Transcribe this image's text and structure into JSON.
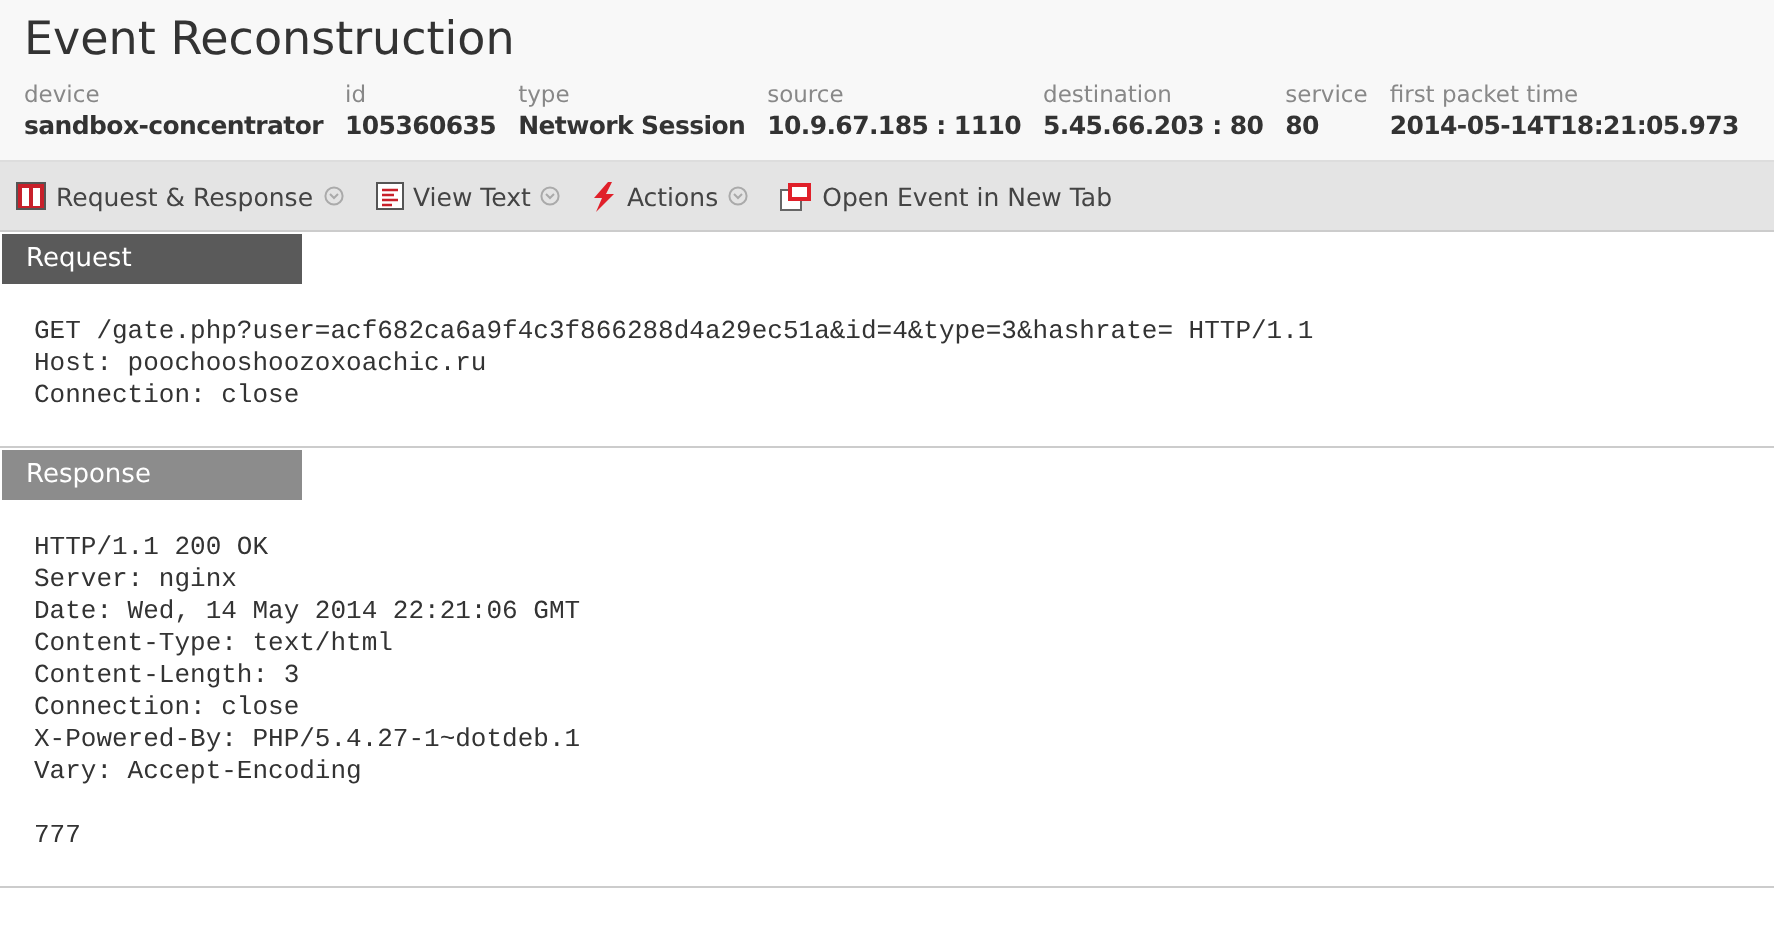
{
  "title": "Event Reconstruction",
  "meta": [
    {
      "label": "device",
      "value": "sandbox-concentrator"
    },
    {
      "label": "id",
      "value": "105360635"
    },
    {
      "label": "type",
      "value": "Network Session"
    },
    {
      "label": "source",
      "value": "10.9.67.185 : 1110"
    },
    {
      "label": "destination",
      "value": "5.45.66.203 : 80"
    },
    {
      "label": "service",
      "value": "80"
    },
    {
      "label": "first packet time",
      "value": "2014-05-14T18:21:05.973"
    }
  ],
  "toolbar": [
    {
      "kind": "layout",
      "label": "Request & Response",
      "has_menu": true
    },
    {
      "kind": "text",
      "label": "View Text",
      "has_menu": true
    },
    {
      "kind": "actions",
      "label": "Actions",
      "has_menu": true
    },
    {
      "kind": "newtab",
      "label": "Open Event in New Tab",
      "has_menu": false
    }
  ],
  "sections": [
    {
      "kind": "request",
      "heading": "Request",
      "lines": [
        "GET /gate.php?user=acf682ca6a9f4c3f866288d4a29ec51a&id=4&type=3&hashrate= HTTP/1.1",
        "Host: poochooshoozoxoachic.ru",
        "Connection: close"
      ]
    },
    {
      "kind": "response",
      "heading": "Response",
      "lines": [
        "HTTP/1.1 200 OK",
        "Server: nginx",
        "Date: Wed, 14 May 2014 22:21:06 GMT",
        "Content-Type: text/html",
        "Content-Length: 3",
        "Connection: close",
        "X-Powered-By: PHP/5.4.27-1~dotdeb.1",
        "Vary: Accept-Encoding"
      ],
      "body": "777"
    }
  ]
}
